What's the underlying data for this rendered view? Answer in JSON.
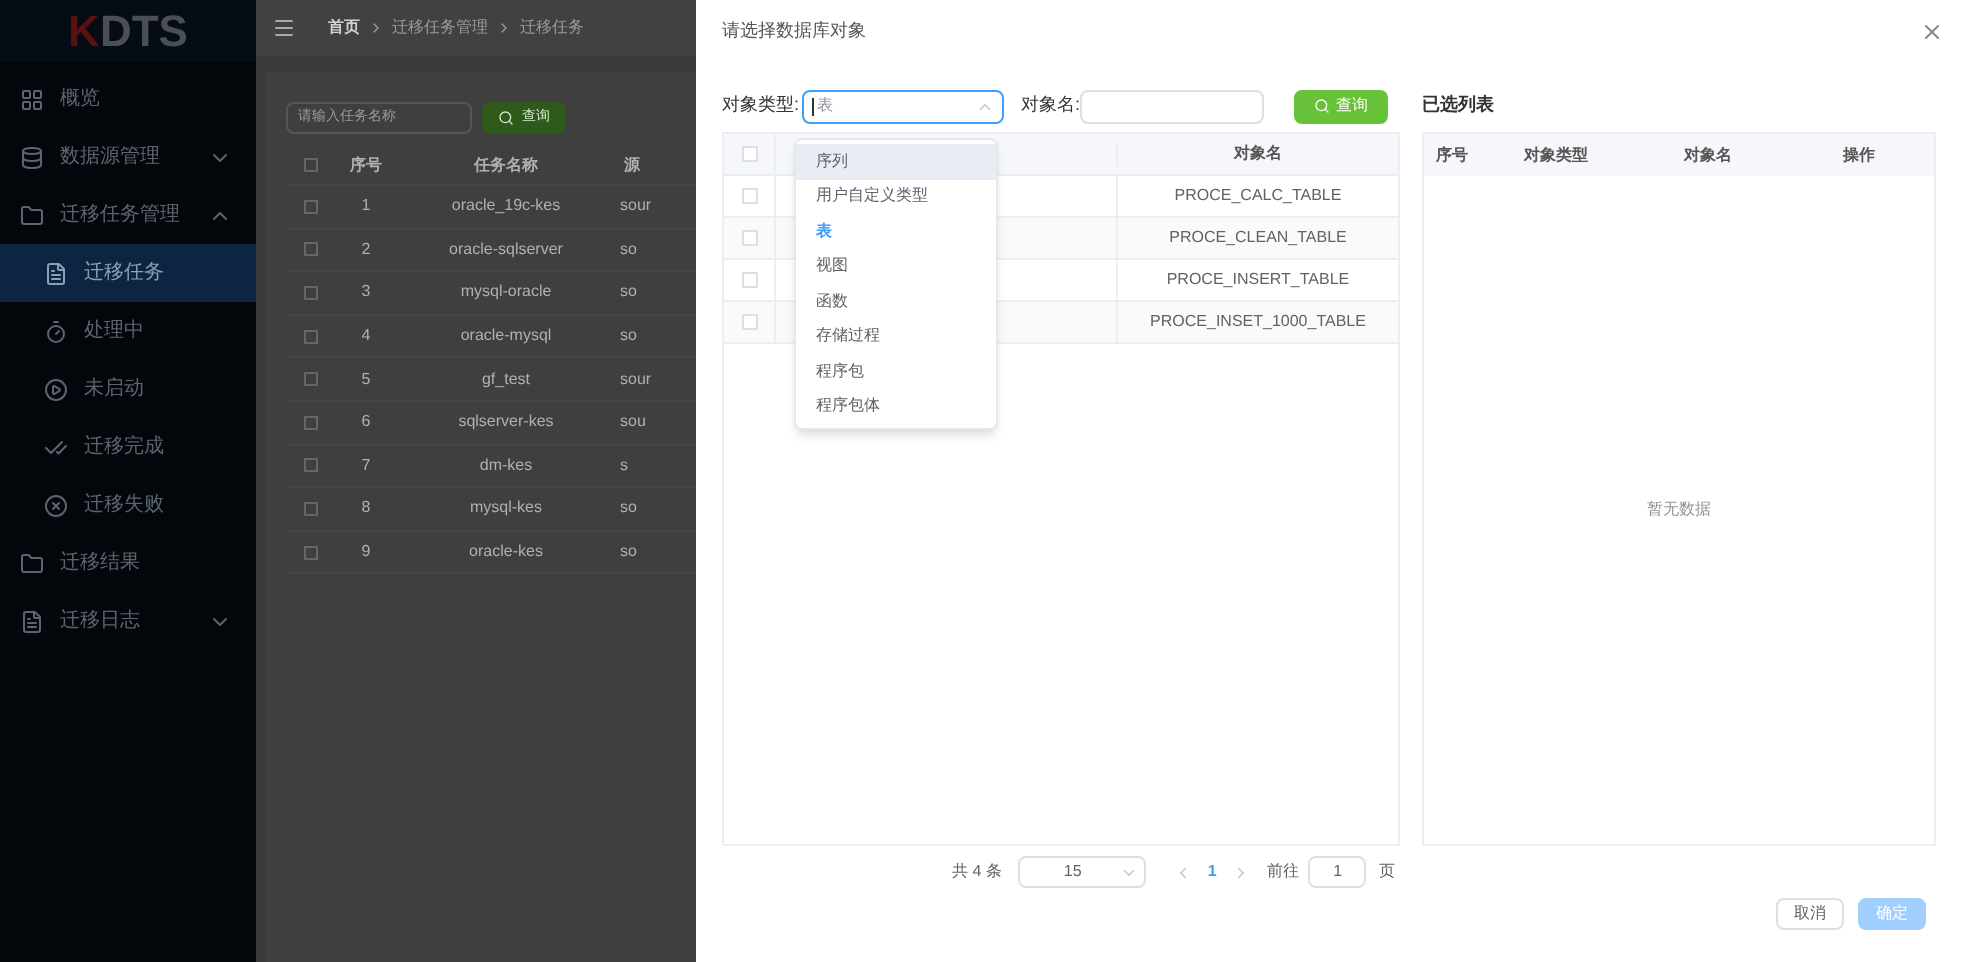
{
  "sidebar": {
    "logo": "DTS",
    "logo_mark": "K",
    "items": [
      {
        "label": "概览",
        "selected": false
      },
      {
        "label": "数据源管理",
        "expanded": false,
        "selected": false
      },
      {
        "label": "迁移任务管理",
        "expanded": true,
        "selected": false,
        "children": [
          {
            "label": "迁移任务",
            "selected": true
          },
          {
            "label": "处理中",
            "selected": false
          },
          {
            "label": "未启动",
            "selected": false
          },
          {
            "label": "迁移完成",
            "selected": false
          },
          {
            "label": "迁移失败",
            "selected": false
          }
        ]
      },
      {
        "label": "迁移结果",
        "selected": false
      },
      {
        "label": "迁移日志",
        "expanded": false,
        "selected": false
      }
    ]
  },
  "breadcrumb": [
    "首页",
    "迁移任务管理",
    "迁移任务"
  ],
  "task_search": {
    "placeholder": "请输入任务名称",
    "button": "查询"
  },
  "task_table": {
    "all_checked": false,
    "columns": [
      "序号",
      "任务名称",
      "源"
    ],
    "rows": [
      {
        "checked": false,
        "cells": [
          "1",
          "oracle_19c-kes",
          "sour"
        ]
      },
      {
        "checked": false,
        "cells": [
          "2",
          "oracle-sqlserver",
          "so"
        ]
      },
      {
        "checked": false,
        "cells": [
          "3",
          "mysql-oracle",
          "so"
        ]
      },
      {
        "checked": false,
        "cells": [
          "4",
          "oracle-mysql",
          "so"
        ]
      },
      {
        "checked": false,
        "cells": [
          "5",
          "gf_test",
          "sour"
        ]
      },
      {
        "checked": false,
        "cells": [
          "6",
          "sqlserver-kes",
          "sou"
        ]
      },
      {
        "checked": false,
        "cells": [
          "7",
          "dm-kes",
          "s"
        ]
      },
      {
        "checked": false,
        "cells": [
          "8",
          "mysql-kes",
          "so"
        ]
      },
      {
        "checked": false,
        "cells": [
          "9",
          "oracle-kes",
          "so"
        ]
      }
    ]
  },
  "dialog": {
    "title": "请选择数据库对象",
    "filter": {
      "type_label": "对象类型:",
      "type_placeholder": "表",
      "name_label": "对象名:",
      "button": "查询"
    },
    "type_options": [
      {
        "label": "序列",
        "selected": false,
        "hovered": true
      },
      {
        "label": "用户自定义类型",
        "selected": false,
        "hovered": false
      },
      {
        "label": "表",
        "selected": true,
        "hovered": false
      },
      {
        "label": "视图",
        "selected": false,
        "hovered": false
      },
      {
        "label": "函数",
        "selected": false,
        "hovered": false
      },
      {
        "label": "存储过程",
        "selected": false,
        "hovered": false
      },
      {
        "label": "程序包",
        "selected": false,
        "hovered": false
      },
      {
        "label": "程序包体",
        "selected": false,
        "hovered": false
      }
    ],
    "object_table": {
      "all_checked": false,
      "columns": [
        "对象名"
      ],
      "rows": [
        {
          "checked": false,
          "name": "PROCE_CALC_TABLE"
        },
        {
          "checked": false,
          "name": "PROCE_CLEAN_TABLE"
        },
        {
          "checked": false,
          "name": "PROCE_INSERT_TABLE"
        },
        {
          "checked": false,
          "name": "PROCE_INSET_1000_TABLE"
        }
      ]
    },
    "pagination": {
      "total": "共 4 条",
      "page_size": "15",
      "current_page": "1",
      "goto_label": "前往",
      "goto_value": "1",
      "page_unit": "页"
    },
    "selected_list": {
      "title": "已选列表",
      "columns": [
        "序号",
        "对象类型",
        "对象名",
        "操作"
      ],
      "empty_text": "暂无数据"
    },
    "buttons": [
      {
        "label": "取消",
        "kind": "default",
        "disabled": false
      },
      {
        "label": "确定",
        "kind": "primary",
        "disabled": true
      }
    ]
  }
}
